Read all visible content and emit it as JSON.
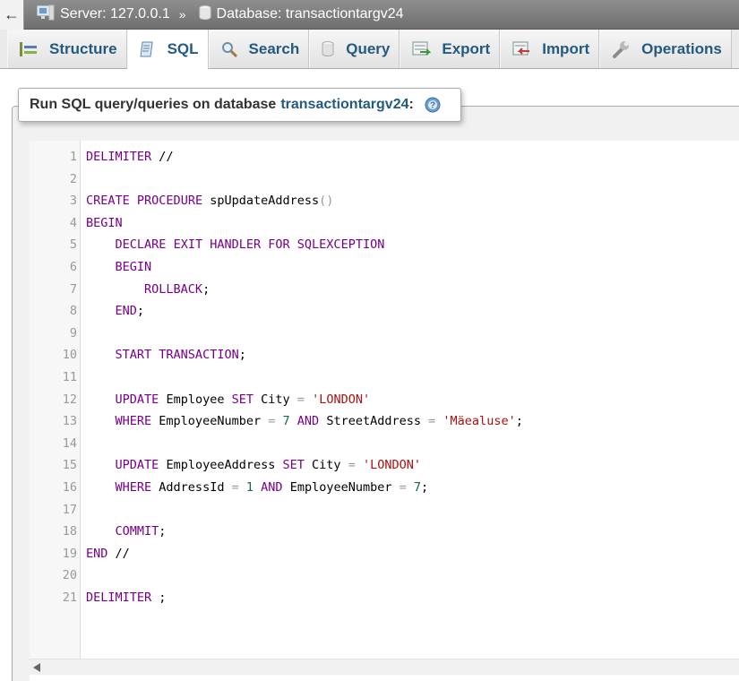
{
  "breadcrumb": {
    "server_label": "Server: 127.0.0.1",
    "separator": "»",
    "database_label": "Database: transactiontargv24"
  },
  "tabs": [
    {
      "label": "Structure",
      "icon": "structure-icon"
    },
    {
      "label": "SQL",
      "icon": "sql-icon",
      "active": true
    },
    {
      "label": "Search",
      "icon": "search-icon"
    },
    {
      "label": "Query",
      "icon": "query-icon"
    },
    {
      "label": "Export",
      "icon": "export-icon"
    },
    {
      "label": "Import",
      "icon": "import-icon"
    },
    {
      "label": "Operations",
      "icon": "wrench-icon"
    }
  ],
  "sql_panel": {
    "legend_prefix": "Run SQL query/queries on database",
    "database_name": "transactiontargv24",
    "legend_suffix": ":"
  },
  "editor": {
    "line_numbers": [
      "1",
      "2",
      "3",
      "4",
      "5",
      "6",
      "7",
      "8",
      "9",
      "10",
      "11",
      "12",
      "13",
      "14",
      "15",
      "16",
      "17",
      "18",
      "19",
      "20",
      "21"
    ],
    "lines": [
      "DELIMITER //",
      "",
      "CREATE PROCEDURE spUpdateAddress()",
      "BEGIN",
      "    DECLARE EXIT HANDLER FOR SQLEXCEPTION",
      "    BEGIN",
      "        ROLLBACK;",
      "    END;",
      "",
      "    START TRANSACTION;",
      "",
      "    UPDATE Employee SET City = 'LONDON'",
      "    WHERE EmployeeNumber = 7 AND StreetAddress = 'Mäealuse';",
      "",
      "    UPDATE EmployeeAddress SET City = 'LONDON'",
      "    WHERE AddressId = 1 AND EmployeeNumber = 7;",
      "",
      "    COMMIT;",
      "END //",
      "",
      "DELIMITER ;"
    ]
  },
  "colors": {
    "keyword": "#770088",
    "string": "#aa1111",
    "number": "#116644",
    "operator": "#999999",
    "link": "#235a81"
  }
}
